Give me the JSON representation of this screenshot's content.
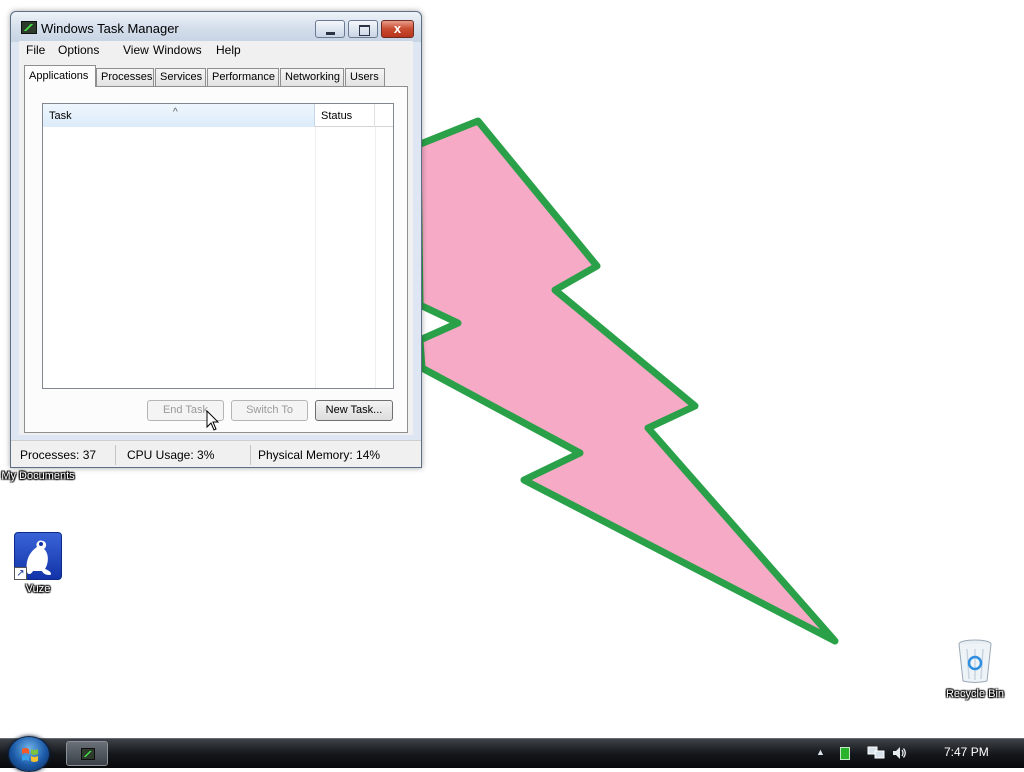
{
  "window": {
    "title": "Windows Task Manager",
    "menu": [
      "File",
      "Options",
      "View",
      "Windows",
      "Help"
    ],
    "tabs": [
      "Applications",
      "Processes",
      "Services",
      "Performance",
      "Networking",
      "Users"
    ],
    "active_tab": "Applications",
    "list": {
      "columns": [
        "Task",
        "Status"
      ],
      "sort_indicator": "^",
      "rows": []
    },
    "buttons": {
      "end_task": "End Task",
      "switch_to": "Switch To",
      "new_task": "New Task..."
    },
    "status": {
      "processes": "Processes: 37",
      "cpu": "CPU Usage: 3%",
      "memory": "Physical Memory: 14%"
    },
    "caption_close": "x"
  },
  "desktop": {
    "icons": [
      {
        "label": "My Documents",
        "icon": "folder-icon"
      },
      {
        "label": "Vuze",
        "icon": "vuze-frog-icon"
      },
      {
        "label": "Recycle Bin",
        "icon": "recycle-bin-icon"
      }
    ],
    "wallpaper": {
      "shape": "lightning-bolt",
      "fill": "#f7aac5",
      "stroke": "#2aa149",
      "background": "#ffffff"
    }
  },
  "taskbar": {
    "clock": "7:47 PM",
    "tray_chevron": "▲",
    "running": [
      "Windows Task Manager"
    ]
  },
  "colors": {
    "close_button": "#c84c2f",
    "taskbar": "#15181c"
  }
}
